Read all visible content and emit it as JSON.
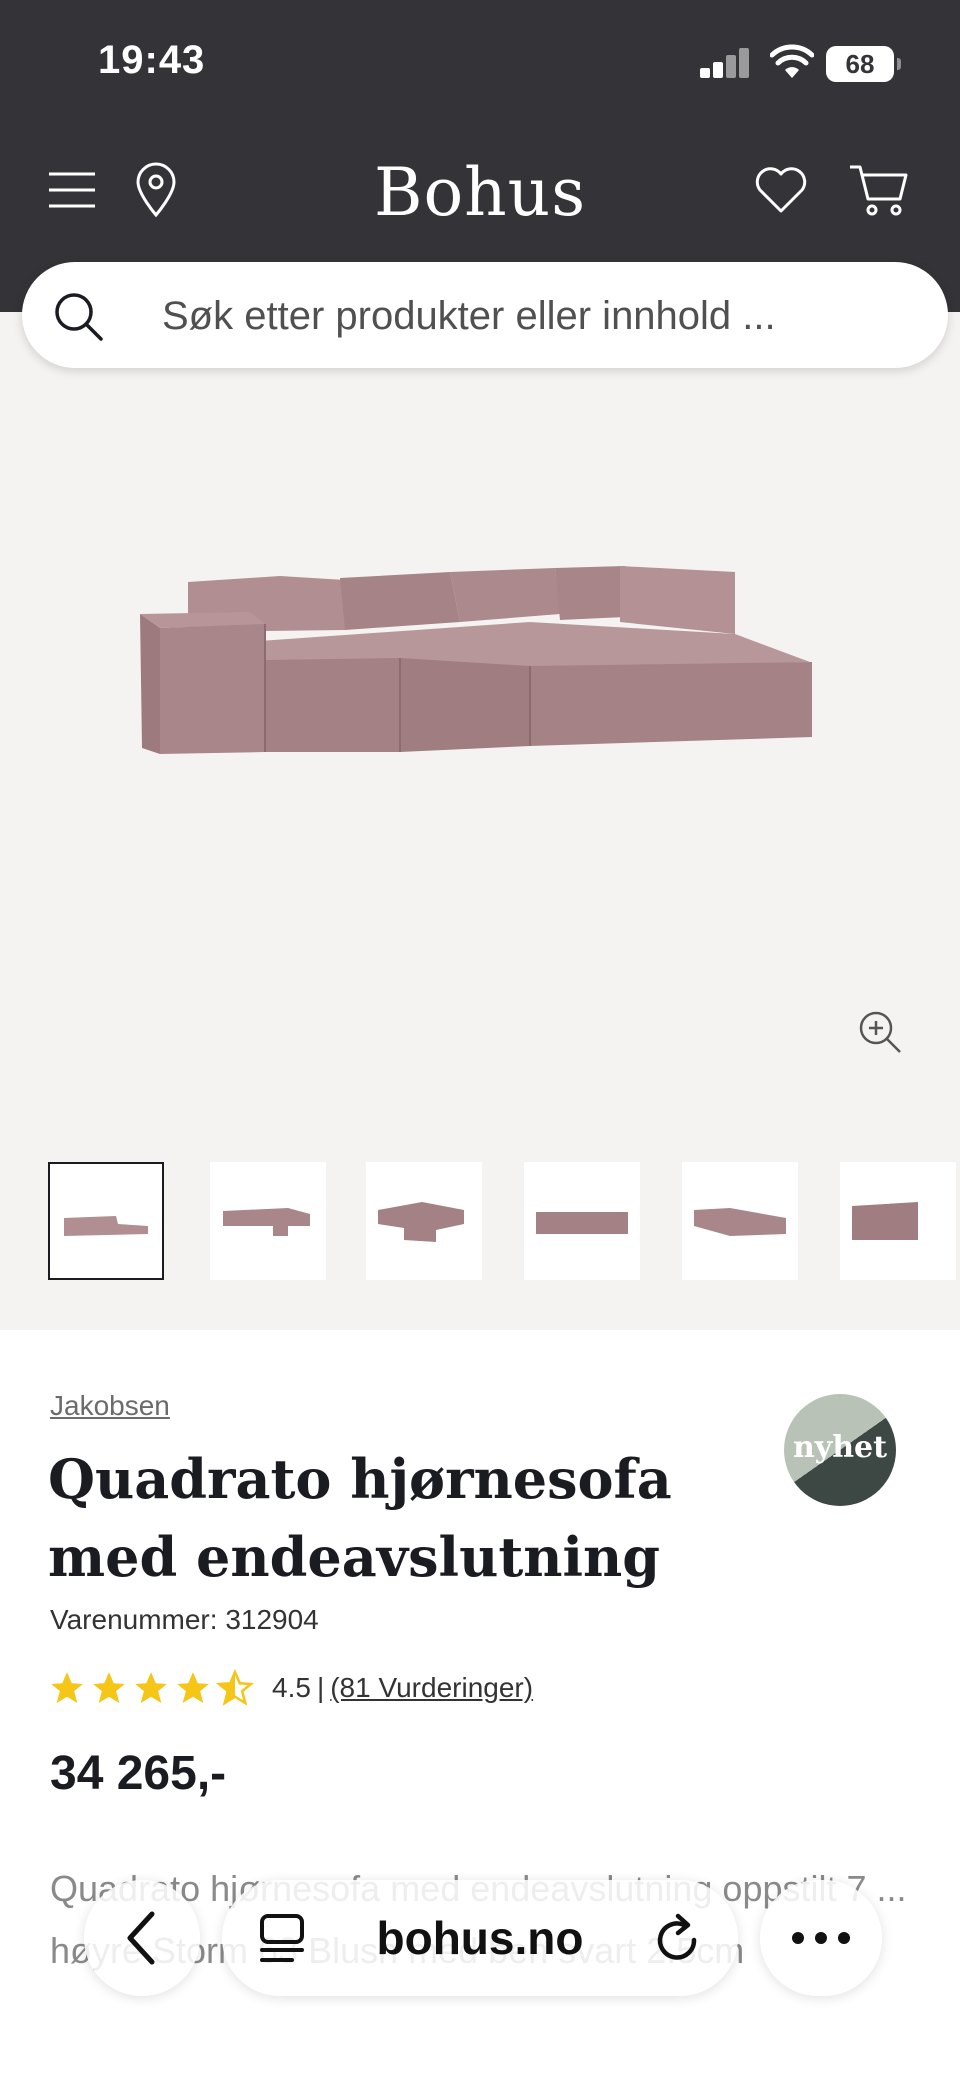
{
  "status_bar": {
    "time": "19:43",
    "battery": "68"
  },
  "header": {
    "brand": "Bohus",
    "colors": {
      "background": "#343338",
      "accent_text": "#ffffff"
    },
    "icons": [
      "menu-icon",
      "location-pin-icon",
      "heart-icon",
      "cart-icon"
    ]
  },
  "search": {
    "placeholder": "Søk etter produkter eller innhold ..."
  },
  "gallery": {
    "thumbnail_count": 6,
    "selected_index": 0
  },
  "product": {
    "brand": "Jakobsen",
    "badge": "nyhet",
    "title": "Quadrato hjørnesofa med endeavslutning",
    "sku_label": "Varenummer: 312904",
    "rating_value": "4.5",
    "rating_separator": "|",
    "rating_count": "(81 Vurderinger)",
    "rating_stars": 4.5,
    "star_color": "#f5c518",
    "price": "34 265,-",
    "description": "Quadrato hjørnesofa med endeavslutning oppstilt 7 ... høyre Storm 63 Blush med ben svart 2.5cm"
  },
  "browser": {
    "url": "bohus.no"
  }
}
